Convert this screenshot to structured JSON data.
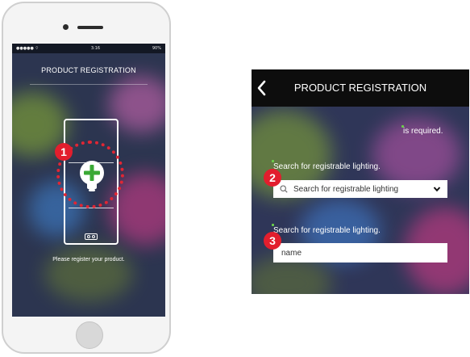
{
  "phone": {
    "status": {
      "carrier": "●●●●● ⌔",
      "time": "3:16",
      "battery": "90%"
    },
    "title": "PRODUCT REGISTRATION",
    "caption": "Please register your product.",
    "badge": "1"
  },
  "panel": {
    "title": "PRODUCT REGISTRATION",
    "required_note": "is required.",
    "search_label": "Search for registrable lighting.",
    "search_placeholder": "Search for registrable lighting",
    "name_label": "Search for registrable lighting.",
    "name_placeholder": "name",
    "badge_search": "2",
    "badge_name": "3"
  },
  "colors": {
    "accent_red": "#e21e2d",
    "required_green": "#6ad04a",
    "plus_green": "#3aa935"
  },
  "icons": [
    "back-arrow-icon",
    "search-icon",
    "chevron-down-icon",
    "lightbulb-plus-icon",
    "device-logo-icon"
  ]
}
